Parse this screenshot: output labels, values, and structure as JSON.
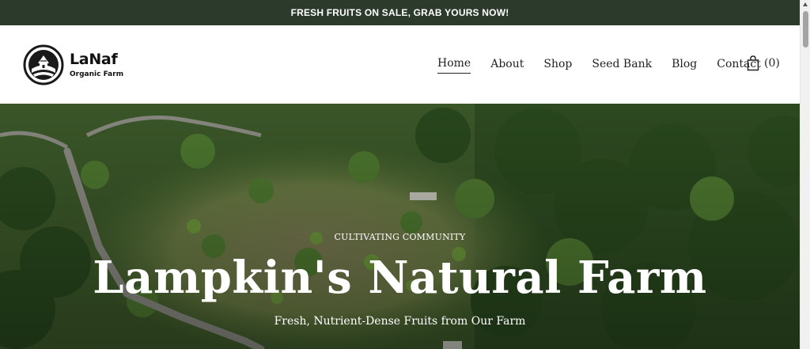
{
  "announcement": {
    "text": "FRESH FRUITS ON SALE, GRAB YOURS NOW!"
  },
  "brand": {
    "name": "LaNaf",
    "tagline": "Organic Farm",
    "logo_icon": "farm-logo-icon"
  },
  "nav": {
    "items": [
      {
        "label": "Home",
        "active": true
      },
      {
        "label": "About",
        "active": false
      },
      {
        "label": "Shop",
        "active": false
      },
      {
        "label": "Seed Bank",
        "active": false
      },
      {
        "label": "Blog",
        "active": false
      },
      {
        "label": "Contact",
        "active": false
      }
    ],
    "cart": {
      "icon": "shopping-bag-icon",
      "count": "(0)"
    }
  },
  "hero": {
    "eyebrow": "CULTIVATING COMMUNITY",
    "title": "Lampkin's Natural Farm",
    "subtitle": "Fresh, Nutrient-Dense Fruits from Our Farm",
    "background": "aerial-farm-photo"
  },
  "colors": {
    "announcement_bg": "#2c3a2c",
    "text": "#222222",
    "hero_text": "#ffffff"
  }
}
